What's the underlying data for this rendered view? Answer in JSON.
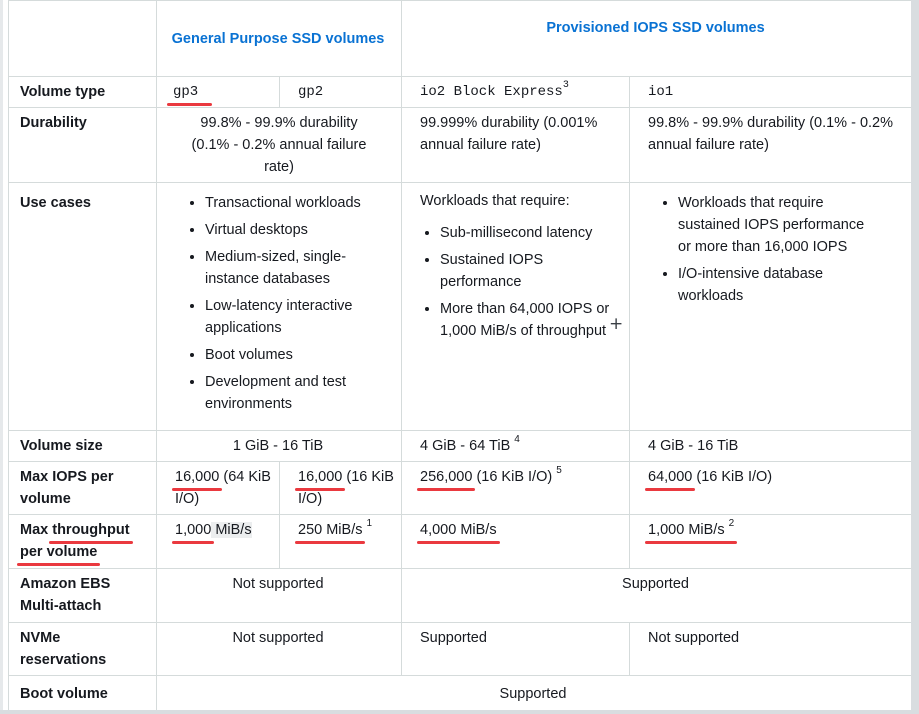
{
  "headers": {
    "gp": "General Purpose SSD volumes",
    "piops": "Provisioned IOPS SSD volumes"
  },
  "rows": {
    "volume_type": {
      "label": "Volume type",
      "gp3": "gp3",
      "gp2": "gp2",
      "io2": "io2 Block Express",
      "io2_sup": "3",
      "io1": "io1"
    },
    "durability": {
      "label": "Durability",
      "gp": "99.8% - 99.9% durability (0.1% - 0.2% annual failure rate)",
      "io2": "99.999% durability (0.001% annual failure rate)",
      "io1": "99.8% - 99.9% durability (0.1% - 0.2% annual failure rate)"
    },
    "use_cases": {
      "label": "Use cases",
      "gp": [
        "Transactional workloads",
        "Virtual desktops",
        "Medium-sized, single-instance databases",
        "Low-latency interactive applications",
        "Boot volumes",
        "Development and test environments"
      ],
      "io2_intro": "Workloads that require:",
      "io2": [
        "Sub-millisecond latency",
        "Sustained IOPS performance",
        "More than 64,000 IOPS or 1,000 MiB/s of throughput"
      ],
      "io1": [
        "Workloads that require sustained IOPS performance or more than 16,000 IOPS",
        "I/O-intensive database workloads"
      ]
    },
    "volume_size": {
      "label": "Volume size",
      "gp": "1 GiB - 16 TiB",
      "io2": "4 GiB - 64 TiB",
      "io2_sup": "4",
      "io1": "4 GiB - 16 TiB"
    },
    "max_iops": {
      "label": "Max IOPS per volume",
      "gp3_value": "16,000",
      "gp3_rest": " (64 KiB I/O)",
      "gp2_value": "16,000",
      "gp2_rest": " (16 KiB I/O)",
      "io2_value": "256,000",
      "io2_rest": " (16 KiB I/O)",
      "io2_sup": "5",
      "io1_value": "64,000",
      "io1_rest": " (16 KiB I/O)"
    },
    "max_throughput": {
      "label_1": "Max ",
      "label_2": "throughput",
      "label_3": "per volume",
      "gp3_value": "1,000",
      "gp3_rest": " MiB/s",
      "gp2": "250 MiB/s",
      "gp2_sup": "1",
      "io2": "4,000 MiB/s",
      "io1": "1,000 MiB/s",
      "io1_sup": "2"
    },
    "multi_attach": {
      "label": "Amazon EBS Multi-attach",
      "gp": "Not supported",
      "piops": "Supported"
    },
    "nvme": {
      "label": "NVMe reservations",
      "gp": "Not supported",
      "io2": "Supported",
      "io1": "Not supported"
    },
    "boot_volume": {
      "label": "Boot volume",
      "all": "Supported"
    }
  },
  "colors": {
    "header_blue": "#0972d3",
    "annotation_red": "#e8232a",
    "border": "#d5dbdb"
  }
}
